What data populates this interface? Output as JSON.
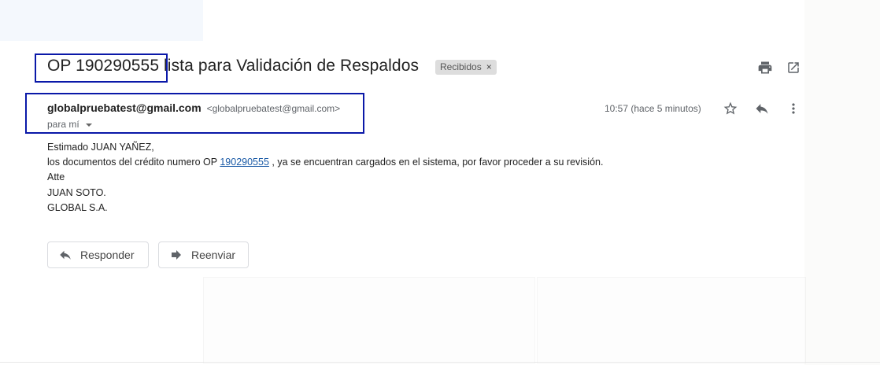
{
  "email": {
    "subject": "OP 190290555 lista para Validación de Respaldos",
    "label": "Recibidos",
    "label_remove": "×",
    "sender_name": "globalpruebatest@gmail.com",
    "sender_email": "<globalpruebatest@gmail.com>",
    "recipient": "para mí",
    "timestamp": "10:57 (hace 5 minutos)",
    "body": {
      "greeting": "Estimado JUAN YAÑEZ,",
      "line1_before": "los documentos del crédito numero OP ",
      "line1_link": "190290555",
      "line1_after": " , ya se encuentran cargados en el sistema, por favor proceder a su revisión.",
      "closing": "Atte",
      "signature_name": "JUAN SOTO.",
      "signature_company": "GLOBAL S.A."
    },
    "buttons": {
      "reply": "Responder",
      "forward": "Reenviar"
    }
  },
  "icons": {
    "print": "print-icon",
    "open_new_window": "open-in-new-window-icon",
    "star": "star-icon",
    "reply": "reply-icon",
    "more": "more-vert-icon",
    "recipient_dropdown": "dropdown-arrow-icon"
  },
  "colors": {
    "link": "#1a5aa6",
    "highlight_box": "#0a18a8",
    "label_chip_bg": "#dddddd"
  }
}
